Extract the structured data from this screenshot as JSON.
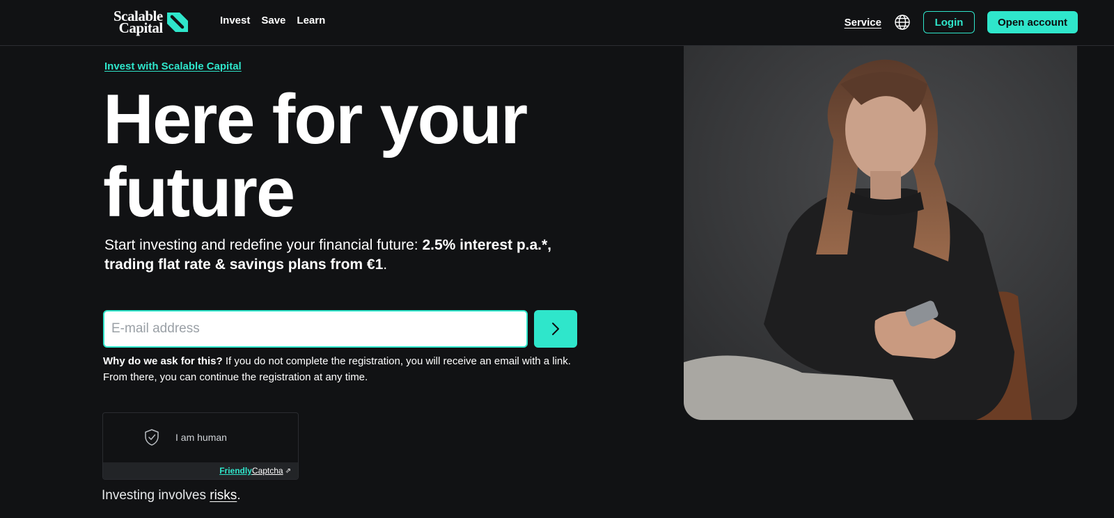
{
  "header": {
    "logo": {
      "line1": "Scalable",
      "line2": "Capital"
    },
    "nav": [
      "Invest",
      "Save",
      "Learn"
    ],
    "service_label": "Service",
    "login_label": "Login",
    "open_account_label": "Open account"
  },
  "hero": {
    "eyebrow": "Invest with Scalable Capital",
    "headline_line1": "Here for your",
    "headline_line2": "future",
    "subline_regular": "Start investing and redefine your financial future: ",
    "subline_bold": "2.5% interest p.a.*, trading flat rate & savings plans from €1",
    "subline_end": "."
  },
  "signup": {
    "email_placeholder": "E-mail address",
    "why_bold": "Why do we ask for this?",
    "why_text": " If you do not complete the registration, you will receive an email with a link. From there, you can continue the registration at any time."
  },
  "captcha": {
    "label": "I am human",
    "brand_friendly": "Friendly",
    "brand_captcha": "Captcha",
    "arrow": "⇗"
  },
  "risk": {
    "prefix": "Investing involves ",
    "link": "risks",
    "suffix": "."
  },
  "colors": {
    "background": "#111214",
    "accent": "#2fe6cb",
    "text": "#ffffff"
  },
  "icons": [
    "logo-mark-icon",
    "globe-icon",
    "chevron-right-icon",
    "shield-check-icon",
    "external-link-icon"
  ]
}
